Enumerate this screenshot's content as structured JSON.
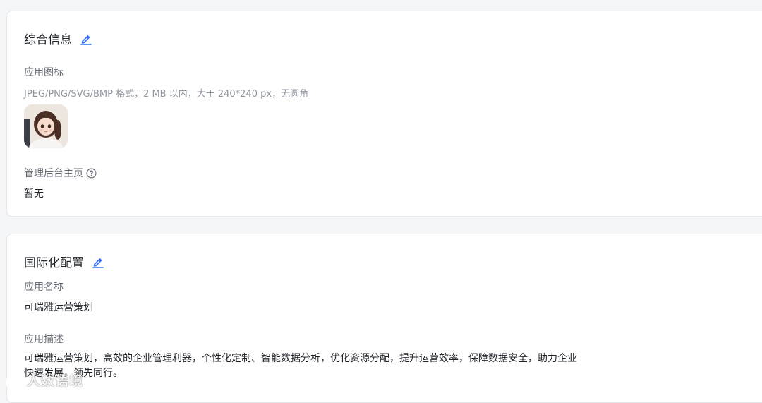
{
  "general": {
    "title": "综合信息",
    "app_icon_label": "应用图标",
    "app_icon_hint": "JPEG/PNG/SVG/BMP 格式，2 MB 以内，大于 240*240 px，无圆角",
    "admin_home_label": "管理后台主页",
    "admin_home_value": "暂无"
  },
  "i18n": {
    "title": "国际化配置",
    "app_name_label": "应用名称",
    "app_name_value": "可瑞雅运营策划",
    "app_desc_label": "应用描述",
    "app_desc_value": "可瑞雅运营策划，高效的企业管理利器，个性化定制、智能数据分析，优化资源分配，提升运营效率，保障数据安全，助力企业快速发展，领先同行。"
  },
  "watermark": {
    "text": "人数语境"
  },
  "colors": {
    "accent": "#3370ff",
    "page_bg": "#f5f6f7",
    "card_bg": "#ffffff",
    "label": "#646a73",
    "hint": "#8f959e",
    "text": "#1f2329"
  }
}
